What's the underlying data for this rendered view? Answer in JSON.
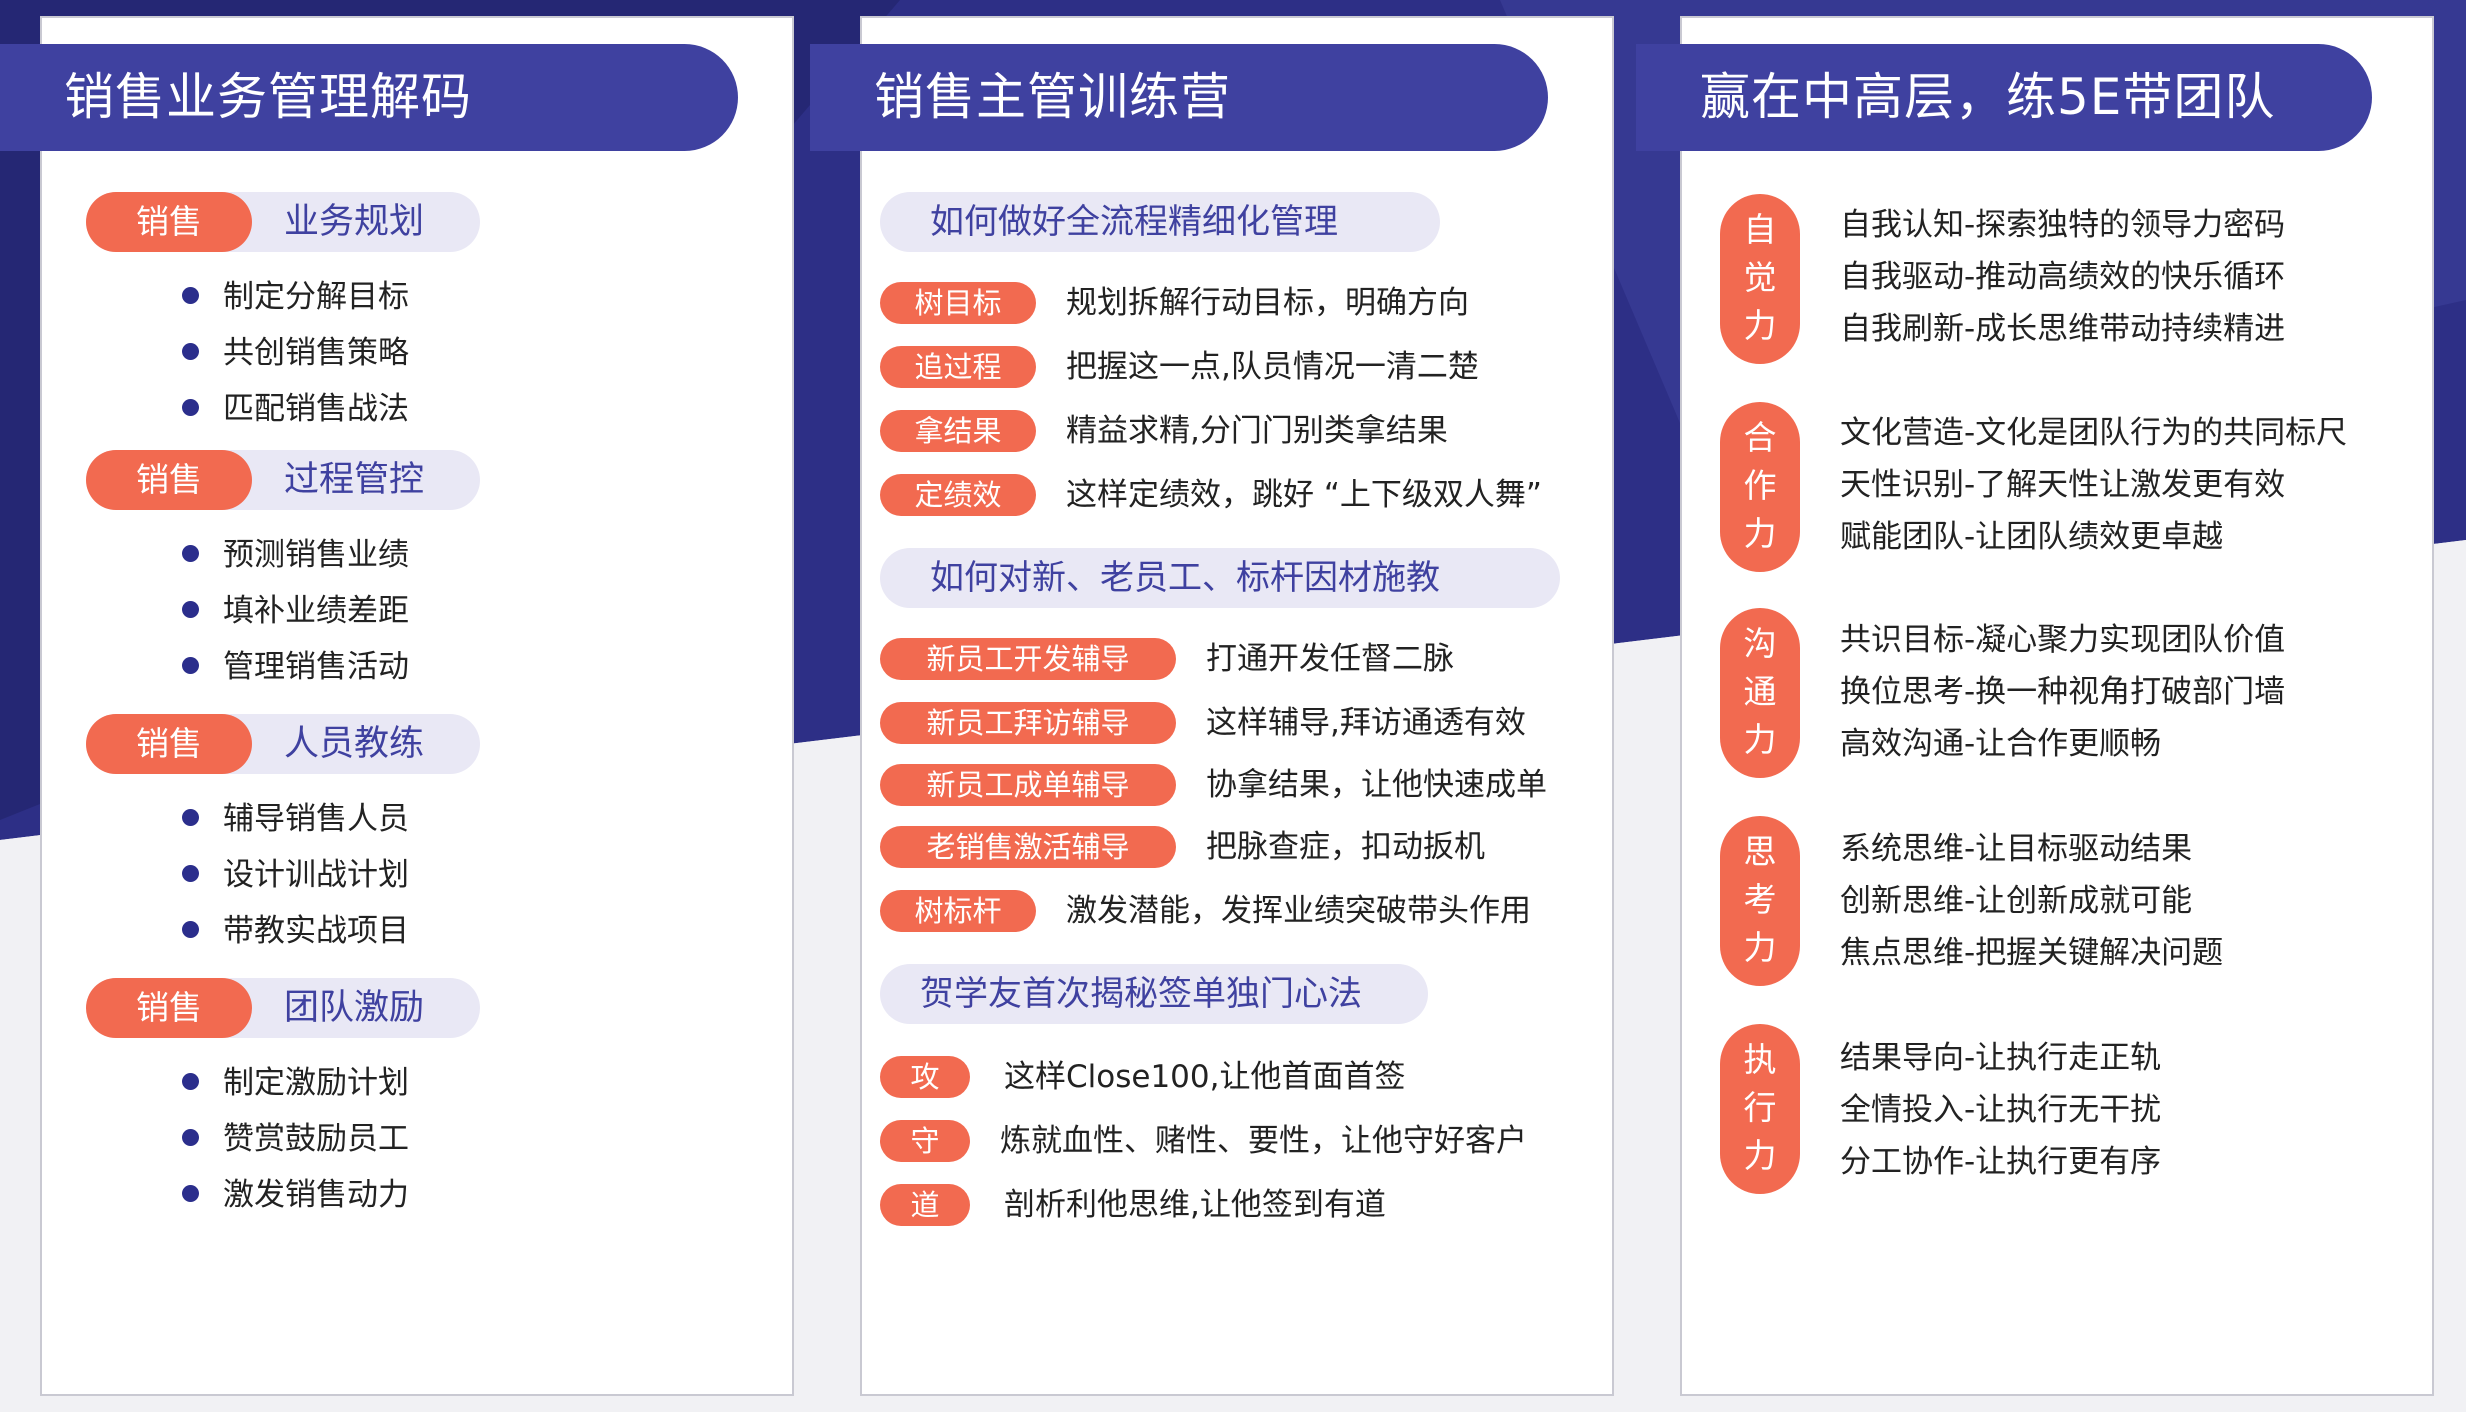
{
  "colors": {
    "accent_blue": "#3f41a0",
    "accent_orange": "#f26a50",
    "light_lavender": "#e9e8f5"
  },
  "card1": {
    "title": "销售业务管理解码",
    "sections": [
      {
        "badge": "销售",
        "title": "业务规划",
        "items": [
          "制定分解目标",
          "共创销售策略",
          "匹配销售战法"
        ]
      },
      {
        "badge": "销售",
        "title": "过程管控",
        "items": [
          "预测销售业绩",
          "填补业绩差距",
          "管理销售活动"
        ]
      },
      {
        "badge": "销售",
        "title": "人员教练",
        "items": [
          "辅导销售人员",
          "设计训战计划",
          "带教实战项目"
        ]
      },
      {
        "badge": "销售",
        "title": "团队激励",
        "items": [
          "制定激励计划",
          "赞赏鼓励员工",
          "激发销售动力"
        ]
      }
    ]
  },
  "card2": {
    "title": "销售主管训练营",
    "groups": [
      {
        "heading": "如何做好全流程精细化管理",
        "rows": [
          {
            "tag": "树目标",
            "text": "规划拆解行动目标，明确方向"
          },
          {
            "tag": "追过程",
            "text": "把握这一点,队员情况一清二楚"
          },
          {
            "tag": "拿结果",
            "text": "精益求精,分门门别类拿结果"
          },
          {
            "tag": "定绩效",
            "text": "这样定绩效，跳好 “上下级双人舞”"
          }
        ]
      },
      {
        "heading": "如何对新、老员工、标杆因材施教",
        "rows": [
          {
            "tag": "新员工开发辅导",
            "text": "打通开发任督二脉"
          },
          {
            "tag": "新员工拜访辅导",
            "text": "这样辅导,拜访通透有效"
          },
          {
            "tag": "新员工成单辅导",
            "text": "协拿结果，让他快速成单"
          },
          {
            "tag": "老销售激活辅导",
            "text": "把脉查症，扣动扳机"
          },
          {
            "tag": "树标杆",
            "text": "激发潜能，发挥业绩突破带头作用"
          }
        ]
      },
      {
        "heading": "贺学友首次揭秘签单独门心法",
        "rows": [
          {
            "tag": "攻",
            "text": "这样Close100,让他首面首签"
          },
          {
            "tag": "守",
            "text": "炼就血性、赌性、要性，让他守好客户"
          },
          {
            "tag": "道",
            "text": "剖析利他思维,让他签到有道"
          }
        ]
      }
    ]
  },
  "card3": {
    "title": "赢在中高层，练5E带团队",
    "groups": [
      {
        "label": [
          "自",
          "觉",
          "力"
        ],
        "lines": [
          "自我认知-探索独特的领导力密码",
          "自我驱动-推动高绩效的快乐循环",
          "自我刷新-成长思维带动持续精进"
        ]
      },
      {
        "label": [
          "合",
          "作",
          "力"
        ],
        "lines": [
          "文化营造-文化是团队行为的共同标尺",
          "天性识别-了解天性让激发更有效",
          "赋能团队-让团队绩效更卓越"
        ]
      },
      {
        "label": [
          "沟",
          "通",
          "力"
        ],
        "lines": [
          "共识目标-凝心聚力实现团队价值",
          "换位思考-换一种视角打破部门墙",
          "高效沟通-让合作更顺畅"
        ]
      },
      {
        "label": [
          "思",
          "考",
          "力"
        ],
        "lines": [
          "系统思维-让目标驱动结果",
          "创新思维-让创新成就可能",
          "焦点思维-把握关键解决问题"
        ]
      },
      {
        "label": [
          "执",
          "行",
          "力"
        ],
        "lines": [
          "结果导向-让执行走正轨",
          "全情投入-让执行无干扰",
          "分工协作-让执行更有序"
        ]
      }
    ]
  }
}
